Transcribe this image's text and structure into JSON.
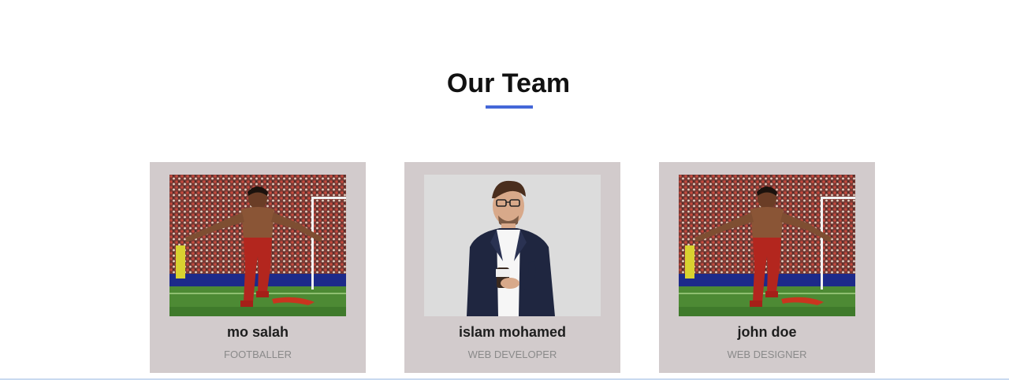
{
  "section": {
    "title": "Our Team"
  },
  "accent_color": "#4467d8",
  "card_color": "#d2cbcc",
  "team": [
    {
      "name": "mo salah",
      "role": "FOOTBALLER",
      "photo": "footballer-photo"
    },
    {
      "name": "islam mohamed",
      "role": "WEB DEVELOPER",
      "photo": "businessman-photo"
    },
    {
      "name": "john doe",
      "role": "WEB DESIGNER",
      "photo": "footballer-photo"
    }
  ]
}
